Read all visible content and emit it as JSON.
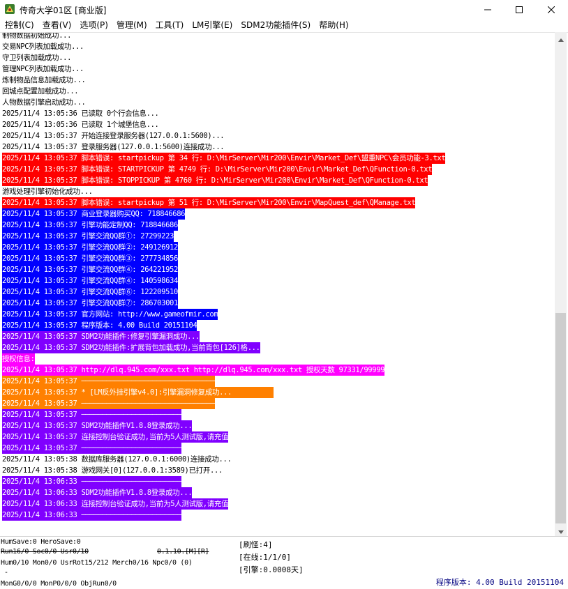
{
  "window": {
    "title": "传奇大学01区 [商业版]",
    "icon": "game-server-app-icon",
    "minimize_icon": "minimize-icon",
    "maximize_icon": "maximize-icon",
    "close_icon": "close-icon"
  },
  "menu": [
    {
      "label": "控制(C)"
    },
    {
      "label": "查看(V)"
    },
    {
      "label": "选项(P)"
    },
    {
      "label": "管理(M)"
    },
    {
      "label": "工具(T)"
    },
    {
      "label": "LM引擎(E)"
    },
    {
      "label": "SDM2功能插件(S)"
    },
    {
      "label": "帮助(H)"
    }
  ],
  "colors": {
    "red": "#ff0000",
    "blue": "#0000ff",
    "magenta": "#ff00ff",
    "orange": "#ff8000",
    "purple": "#8000ff",
    "white_text": "#ffffff",
    "black_text": "#000000",
    "version_text": "#000080"
  },
  "log": [
    {
      "text": "制物数据初始成功...",
      "bg": "",
      "fg": "#000000"
    },
    {
      "text": "交易NPC列表加载成功...",
      "bg": "",
      "fg": "#000000"
    },
    {
      "text": "守卫列表加载成功...",
      "bg": "",
      "fg": "#000000"
    },
    {
      "text": "管理NPC列表加载成功...",
      "bg": "",
      "fg": "#000000"
    },
    {
      "text": "炼制物品信息加载成功...",
      "bg": "",
      "fg": "#000000"
    },
    {
      "text": "回城点配置加载成功...",
      "bg": "",
      "fg": "#000000"
    },
    {
      "text": "人物数据引擎启动成功...",
      "bg": "",
      "fg": "#000000"
    },
    {
      "text": "2025/11/4 13:05:36 已读取 0个行会信息...",
      "bg": "",
      "fg": "#000000"
    },
    {
      "text": "2025/11/4 13:05:36 已读取 1个城堡信息...",
      "bg": "",
      "fg": "#000000"
    },
    {
      "text": "2025/11/4 13:05:37 开始连接登录服务器(127.0.0.1:5600)...",
      "bg": "",
      "fg": "#000000"
    },
    {
      "text": "2025/11/4 13:05:37 登录服务器(127.0.0.1:5600)连接成功...",
      "bg": "",
      "fg": "#000000"
    },
    {
      "text": "2025/11/4 13:05:37 脚本错误: startpickup 第 34 行: D:\\MirServer\\Mir200\\Envir\\Market_Def\\盟重NPC\\会员功能-3.txt",
      "bg": "#ff0000",
      "fg": "#ffffff"
    },
    {
      "text": "2025/11/4 13:05:37 脚本错误: STARTPICKUP 第 4749 行: D:\\MirServer\\Mir200\\Envir\\Market_Def\\QFunction-0.txt",
      "bg": "#ff0000",
      "fg": "#ffffff"
    },
    {
      "text": "2025/11/4 13:05:37 脚本错误: STOPPICKUP 第 4760 行: D:\\MirServer\\Mir200\\Envir\\Market_Def\\QFunction-0.txt",
      "bg": "#ff0000",
      "fg": "#ffffff"
    },
    {
      "text": "游戏处理引擎初始化成功...",
      "bg": "",
      "fg": "#000000"
    },
    {
      "text": "2025/11/4 13:05:37 脚本错误: startpickup 第 51 行: D:\\MirServer\\Mir200\\Envir\\MapQuest_def\\QManage.txt",
      "bg": "#ff0000",
      "fg": "#ffffff"
    },
    {
      "text": "2025/11/4 13:05:37 商业登录器购买QQ: 718846686",
      "bg": "#0000ff",
      "fg": "#ffffff"
    },
    {
      "text": "2025/11/4 13:05:37 引擎功能定制QQ: 718846686",
      "bg": "#0000ff",
      "fg": "#ffffff"
    },
    {
      "text": "2025/11/4 13:05:37 引擎交流QQ群①: 27299223",
      "bg": "#0000ff",
      "fg": "#ffffff"
    },
    {
      "text": "2025/11/4 13:05:37 引擎交流QQ群②: 249126912",
      "bg": "#0000ff",
      "fg": "#ffffff"
    },
    {
      "text": "2025/11/4 13:05:37 引擎交流QQ群③: 277734856",
      "bg": "#0000ff",
      "fg": "#ffffff"
    },
    {
      "text": "2025/11/4 13:05:37 引擎交流QQ群④: 264221952",
      "bg": "#0000ff",
      "fg": "#ffffff"
    },
    {
      "text": "2025/11/4 13:05:37 引擎交流QQ群④: 140598634",
      "bg": "#0000ff",
      "fg": "#ffffff"
    },
    {
      "text": "2025/11/4 13:05:37 引擎交流QQ群⑥: 122209510",
      "bg": "#0000ff",
      "fg": "#ffffff"
    },
    {
      "text": "2025/11/4 13:05:37 引擎交流QQ群⑦: 286703001",
      "bg": "#0000ff",
      "fg": "#ffffff"
    },
    {
      "text": "2025/11/4 13:05:37 官方网站: http://www.gameofmir.com",
      "bg": "#0000ff",
      "fg": "#ffffff"
    },
    {
      "text": "2025/11/4 13:05:37 程序版本: 4.00 Build 20151104",
      "bg": "#0000ff",
      "fg": "#ffffff"
    },
    {
      "text": "2025/11/4 13:05:37 SDM2功能插件:修复引擎漏洞成功...",
      "bg": "#8000ff",
      "fg": "#ffffff"
    },
    {
      "text": "2025/11/4 13:05:37 SDM2功能插件:扩展背包加载成功,当前背包[126]格...",
      "bg": "#8000ff",
      "fg": "#ffffff"
    },
    {
      "text": "授权信息:",
      "bg": "#ff00ff",
      "fg": "#ffffff"
    },
    {
      "text": "2025/11/4 13:05:37 http://dlq.945.com/xxx.txt http://dlq.945.com/xxx.txt 授权天数 97331/99999",
      "bg": "#ff00ff",
      "fg": "#ffffff"
    },
    {
      "text": "2025/11/4 13:05:37 ────────────────────────────────",
      "bg": "#ff8000",
      "fg": "#ffffff"
    },
    {
      "text": "2025/11/4 13:05:37 * [LM反外挂引擎v4.0]:引擎漏洞修复成功...          ",
      "bg": "#ff8000",
      "fg": "#ffffff"
    },
    {
      "text": "2025/11/4 13:05:37 ────────────────────────────────",
      "bg": "#ff8000",
      "fg": "#ffffff"
    },
    {
      "text": "2025/11/4 13:05:37 ────────────────────────",
      "bg": "#8000ff",
      "fg": "#ffffff"
    },
    {
      "text": "2025/11/4 13:05:37 SDM2功能插件V1.8.8登录成功...",
      "bg": "#8000ff",
      "fg": "#ffffff"
    },
    {
      "text": "2025/11/4 13:05:37 连接控制台验证成功,当前为5人测试版,请充值",
      "bg": "#8000ff",
      "fg": "#ffffff"
    },
    {
      "text": "2025/11/4 13:05:37 ────────────────────────",
      "bg": "#8000ff",
      "fg": "#ffffff"
    },
    {
      "text": "2025/11/4 13:05:38 数据库服务器(127.0.0.1:6000)连接成功...",
      "bg": "",
      "fg": "#000000"
    },
    {
      "text": "2025/11/4 13:05:38 游戏网关[0](127.0.0.1:3589)已打开...",
      "bg": "",
      "fg": "#000000"
    },
    {
      "text": "2025/11/4 13:06:33 ────────────────────────",
      "bg": "#8000ff",
      "fg": "#ffffff"
    },
    {
      "text": "2025/11/4 13:06:33 SDM2功能插件V1.8.8登录成功...",
      "bg": "#8000ff",
      "fg": "#ffffff"
    },
    {
      "text": "2025/11/4 13:06:33 连接控制台验证成功,当前为5人测试版,请充值",
      "bg": "#8000ff",
      "fg": "#ffffff"
    },
    {
      "text": "2025/11/4 13:06:33 ────────────────────────",
      "bg": "#8000ff",
      "fg": "#ffffff"
    }
  ],
  "scrollbar": {
    "up_icon": "scroll-up-arrow-icon",
    "down_icon": "scroll-down-arrow-icon"
  },
  "status": {
    "save_info": "HumSave:0 HeroSave:0",
    "run_info": "Run16/0 Soc0/0 Usr0/10",
    "map_info": "0.1.10.[M][R]",
    "hum_info": "Hum0/10 Mon0/0 UsrRot15/212 Merch0/16 Npc0/0 (0)",
    "dash": "-",
    "mon_info": "MonG0/0/0 MonP0/0/0 ObjRun0/0",
    "refresh_monster": "[刷怪:4]",
    "online": "[在线:1/1/0]",
    "engine": "[引擎:0.0008天]",
    "version": "程序版本: 4.00 Build 20151104"
  }
}
